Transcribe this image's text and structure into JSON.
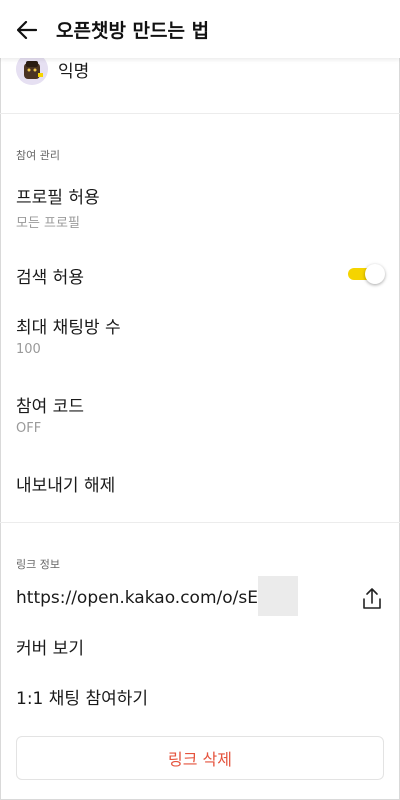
{
  "header": {
    "title": "오픈챗방 만드는 법"
  },
  "profile": {
    "name": "익명"
  },
  "participation": {
    "section_label": "참여 관리",
    "items": [
      {
        "title": "프로필 허용",
        "sub": "모든 프로필"
      },
      {
        "title": "검색 허용",
        "toggle_on": true
      },
      {
        "title": "최대 채팅방 수",
        "sub": "100"
      },
      {
        "title": "참여 코드",
        "sub": "OFF"
      },
      {
        "title": "내보내기 해제"
      }
    ]
  },
  "link_info": {
    "section_label": "링크 정보",
    "url": "https://open.kakao.com/o/sE   Jfgc",
    "cover_label": "커버 보기",
    "one_on_one_label": "1:1 채팅 참여하기",
    "delete_label": "링크 삭제"
  },
  "colors": {
    "toggle_accent": "#f5d400",
    "delete_text": "#e5533d"
  }
}
